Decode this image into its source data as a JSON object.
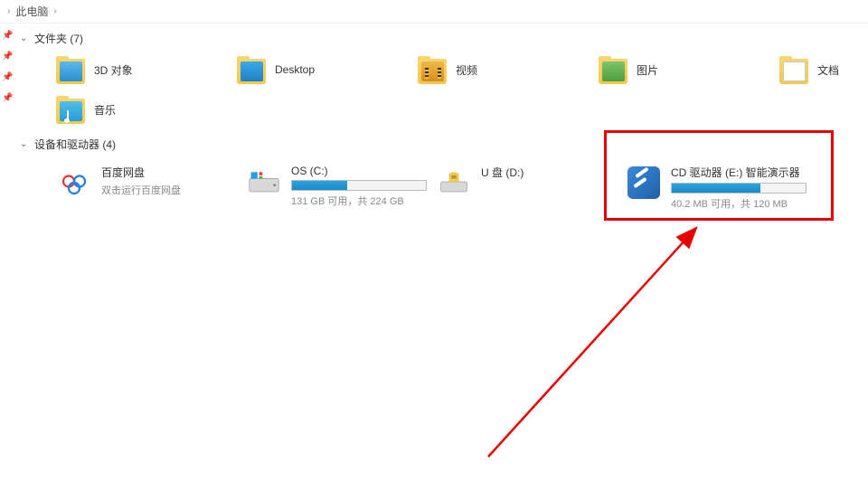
{
  "breadcrumb": {
    "location": "此电脑"
  },
  "sections": {
    "folders": {
      "title": "文件夹 (7)",
      "items": [
        {
          "label": "3D 对象",
          "kind": "3d"
        },
        {
          "label": "Desktop",
          "kind": "desktop"
        },
        {
          "label": "视频",
          "kind": "video"
        },
        {
          "label": "图片",
          "kind": "image"
        },
        {
          "label": "文档",
          "kind": "doc"
        },
        {
          "label": "音乐",
          "kind": "music"
        }
      ]
    },
    "devices": {
      "title": "设备和驱动器 (4)",
      "items": [
        {
          "name": "百度网盘",
          "subtitle": "双击运行百度网盘",
          "kind": "baidu"
        },
        {
          "name": "OS (C:)",
          "kind": "disk",
          "used_pct": 41,
          "storage_text": "131 GB 可用，共 224 GB"
        },
        {
          "name": "U 盘 (D:)",
          "kind": "usb"
        },
        {
          "name": "CD 驱动器 (E:) 智能演示器",
          "kind": "cd",
          "used_pct": 66,
          "storage_text": "40.2 MB 可用，共 120 MB"
        }
      ]
    }
  }
}
